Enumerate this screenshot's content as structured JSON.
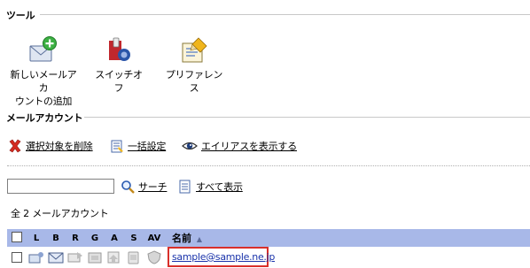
{
  "sections": {
    "tools_title": "ツール",
    "accounts_title": "メールアカウント"
  },
  "tools": {
    "new_account_line1": "新しいメールアカ",
    "new_account_line2": "ウントの追加",
    "switch_off": "スイッチオフ",
    "preferences": "プリファレンス"
  },
  "actions": {
    "delete_selected": "選択対象を削除",
    "bulk_settings": "一括設定",
    "show_aliases": "エイリアスを表示する"
  },
  "search": {
    "value": "",
    "search_label": "サーチ",
    "show_all_label": "すべて表示"
  },
  "list": {
    "count_text": "全 2 メールアカウント",
    "columns": [
      "L",
      "B",
      "R",
      "G",
      "A",
      "S",
      "AV"
    ],
    "name_header": "名前",
    "sort_indicator": "▲",
    "rows": [
      {
        "email": "sample@sample.ne.jp"
      }
    ]
  },
  "colors": {
    "table_header_bg": "#a8b8e8",
    "highlight_border": "#d9302b",
    "link_color": "#1a33aa"
  }
}
